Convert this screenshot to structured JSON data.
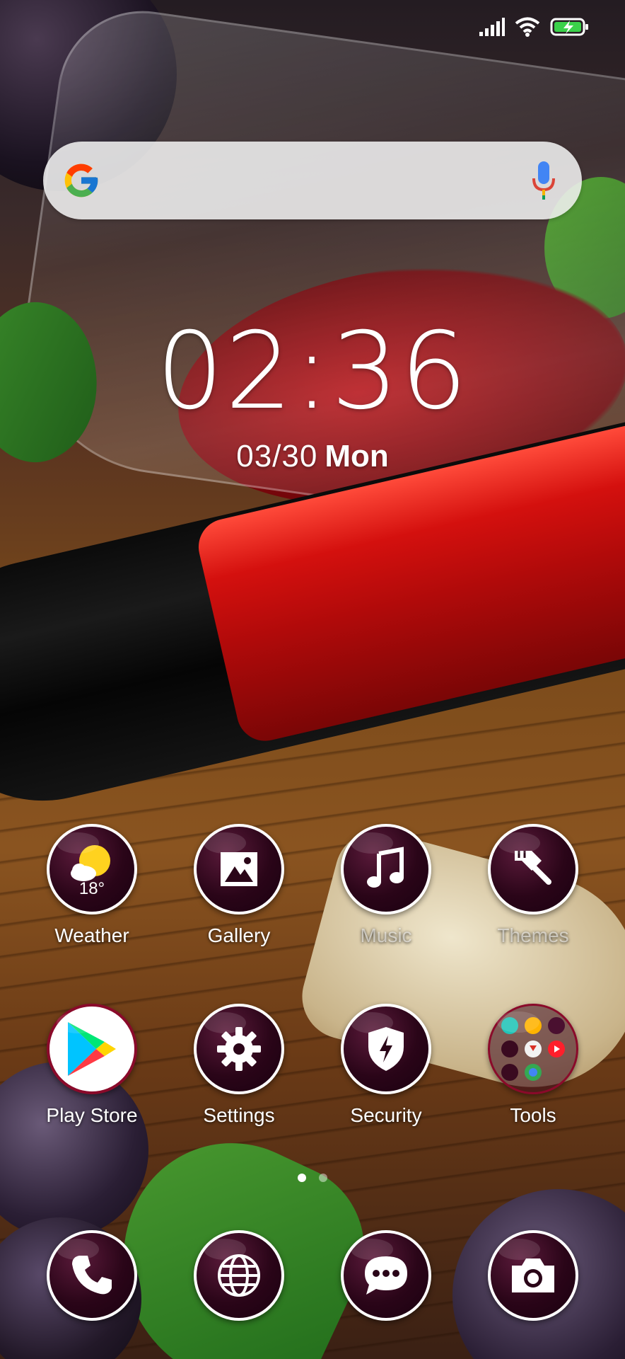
{
  "status_bar": {
    "icons": [
      "signal-icon",
      "wifi-icon",
      "battery-charging-icon"
    ]
  },
  "search": {
    "logo": "google-logo",
    "mic": "mic-icon"
  },
  "clock": {
    "time": "02:36",
    "date": "03/30",
    "weekday": "Mon"
  },
  "apps": {
    "weather": {
      "label": "Weather",
      "temp": "18°",
      "icon": "weather-sun-cloud-icon"
    },
    "gallery": {
      "label": "Gallery",
      "icon": "gallery-icon"
    },
    "music": {
      "label": "Music",
      "icon": "music-note-icon"
    },
    "themes": {
      "label": "Themes",
      "icon": "paint-brush-icon"
    },
    "playstore": {
      "label": "Play Store",
      "icon": "play-store-icon"
    },
    "settings": {
      "label": "Settings",
      "icon": "gear-icon"
    },
    "security": {
      "label": "Security",
      "icon": "shield-bolt-icon"
    },
    "tools": {
      "label": "Tools",
      "icon": "folder-icon"
    }
  },
  "pages": {
    "count": 2,
    "active": 1
  },
  "dock": {
    "items": [
      "phone-icon",
      "browser-globe-icon",
      "messaging-icon",
      "camera-icon"
    ]
  },
  "colors": {
    "icon_bg": "#2a0518",
    "icon_ring": "#ffffff",
    "accent_red": "#d4100e"
  }
}
